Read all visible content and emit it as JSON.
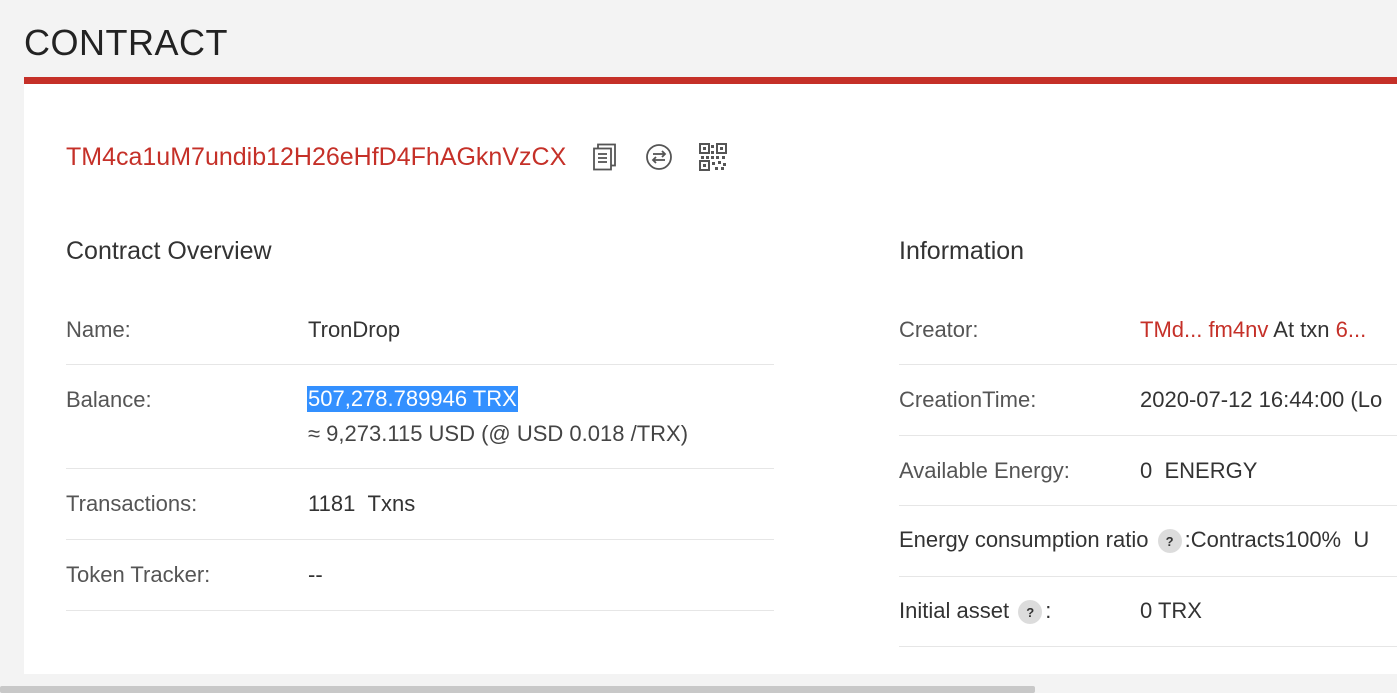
{
  "page": {
    "title": "CONTRACT"
  },
  "contract": {
    "address": "TM4ca1uM7undib12H26eHfD4FhAGknVzCX",
    "icons": [
      "copy-icon",
      "convert-icon",
      "qr-code-icon"
    ]
  },
  "overview": {
    "title": "Contract Overview",
    "name_label": "Name:",
    "name_value": "TronDrop",
    "balance_label": "Balance:",
    "balance_value": "507,278.789946 TRX",
    "balance_usd": "≈ 9,273.115 USD (@ USD 0.018 /TRX)",
    "transactions_label": "Transactions:",
    "transactions_count": "1181",
    "transactions_unit": "Txns",
    "token_tracker_label": "Token Tracker:",
    "token_tracker_value": "--"
  },
  "information": {
    "title": "Information",
    "creator_label": "Creator:",
    "creator_address": "TMd... fm4nv",
    "creator_at_txn": "At txn",
    "creator_txn": "6...",
    "creation_time_label": "CreationTime:",
    "creation_time_value": "2020-07-12 16:44:00 (Lo",
    "energy_label": "Available Energy:",
    "energy_value": "0",
    "energy_unit": "ENERGY",
    "ratio_label": "Energy consumption ratio",
    "ratio_value": ":Contracts100%",
    "ratio_trailing": "U",
    "initial_asset_label": "Initial asset",
    "initial_asset_colon": ":",
    "initial_asset_value": "0 TRX",
    "help_glyph": "?"
  },
  "colors": {
    "accent": "#c53028",
    "selection": "#3390ff"
  }
}
